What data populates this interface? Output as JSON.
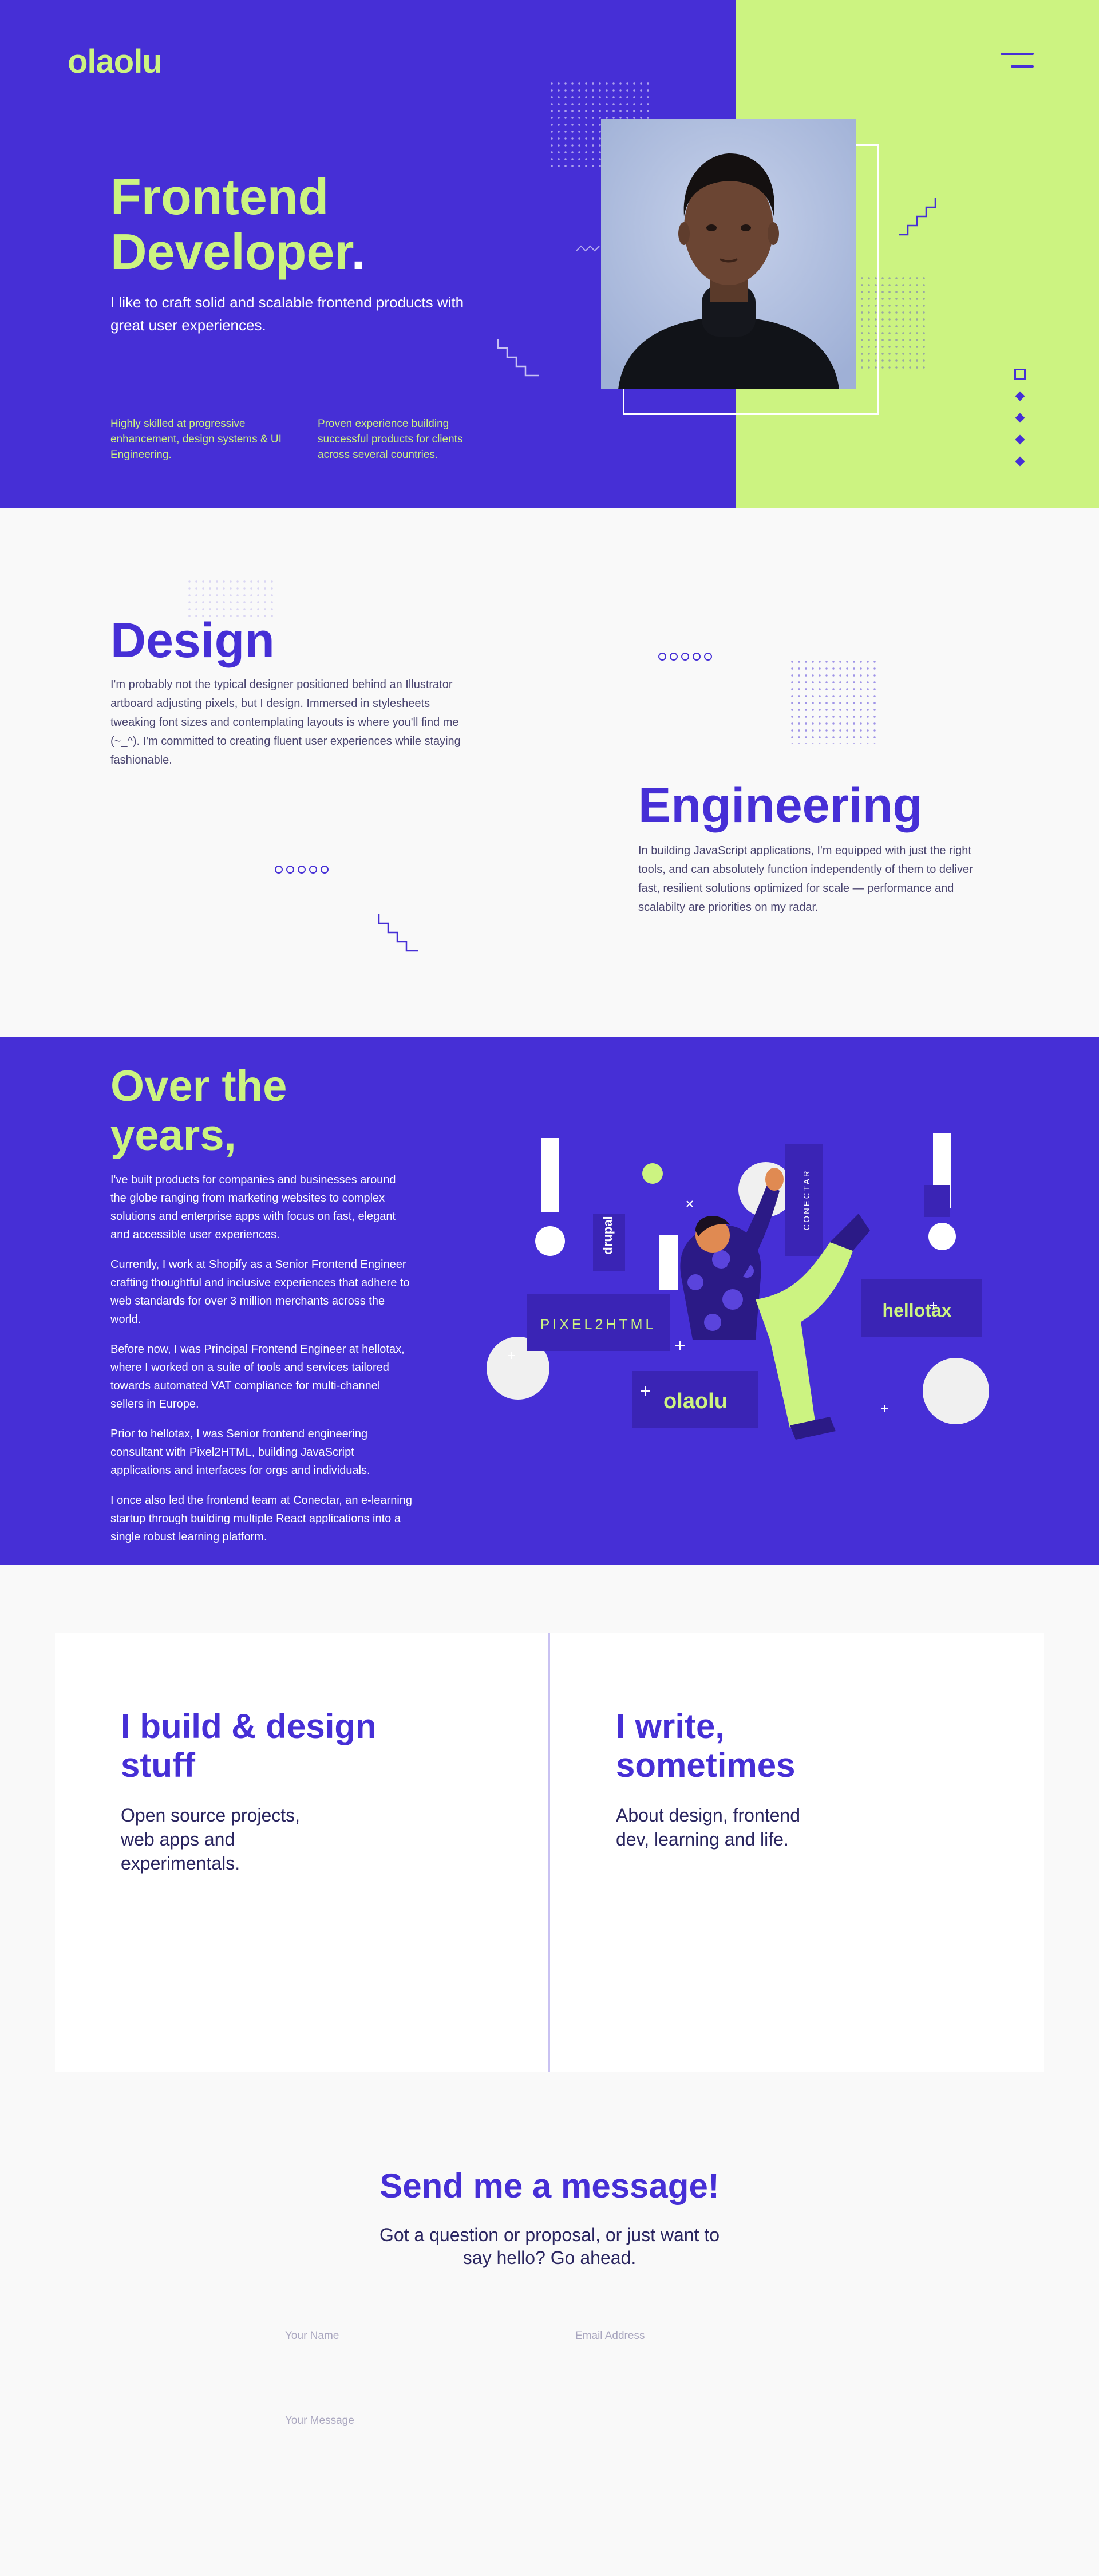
{
  "colors": {
    "brand": "#462fd6",
    "accent": "#ccf381",
    "background": "#f9f9f9",
    "text": "#2a2560"
  },
  "header": {
    "logo": "olaolu",
    "menu_icon": "hamburger-icon"
  },
  "hero": {
    "title_line1": "Frontend",
    "title_line2": "Developer",
    "title_dot": ".",
    "subtitle": "I like to craft solid and scalable frontend products with great user experiences.",
    "note1": "Highly skilled at progressive enhancement, design systems & UI Engineering.",
    "note2": "Proven experience building successful products for clients across several countries."
  },
  "design": {
    "title": "Design",
    "text": "I'm probably not the typical designer positioned behind an Illustrator artboard adjusting pixels, but I design. Immersed in stylesheets tweaking font sizes and contemplating layouts is where you'll find me (~_^). I'm committed to creating fluent user experiences while staying fashionable."
  },
  "engineering": {
    "title": "Engineering",
    "text": "In building JavaScript applications, I'm equipped with just the right tools, and can absolutely function independently of them to deliver fast, resilient solutions optimized for scale — performance and scalabilty are priorities on my radar."
  },
  "years": {
    "title_line1": "Over the",
    "title_line2": "years,",
    "paragraphs": [
      "I've built products for companies and businesses around the globe ranging from marketing websites to complex solutions and enterprise apps with focus on fast, elegant and accessible user experiences.",
      "Currently, I work at Shopify as a Senior Frontend Engineer crafting thoughtful and inclusive experiences that adhere to web standards for over 3 million merchants across the world.",
      "Before now, I was Principal Frontend Engineer at hellotax, where I worked on a suite of tools and services tailored towards automated VAT compliance for multi-channel sellers in Europe.",
      "Prior to hellotax, I was Senior frontend engineering consultant with Pixel2HTML, building JavaScript applications and interfaces for orgs and individuals.",
      "I once also led the frontend team at Conectar, an e-learning startup through building multiple React applications into a single robust learning platform."
    ],
    "brands": {
      "pixel": "PIXEL2HTML",
      "hellotax": "hellotax",
      "olaolu": "olaolu",
      "conectar": "CONECTAR",
      "drupal": "drupal"
    }
  },
  "cards": {
    "build_title": "I build & design stuff",
    "build_text": "Open source projects, web apps and experimentals.",
    "write_title": "I write, sometimes",
    "write_text": "About design, frontend dev, learning and life."
  },
  "contact": {
    "title": "Send me a message!",
    "subtitle": "Got a question or proposal, or just want to say hello? Go ahead.",
    "name_placeholder": "Your Name",
    "email_placeholder": "Email Address",
    "message_placeholder": "Your Message"
  }
}
